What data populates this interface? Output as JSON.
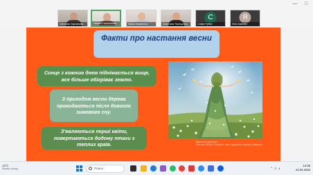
{
  "participants": [
    {
      "name": "Світлана Харланова"
    },
    {
      "name": "Наталя Горілянська"
    },
    {
      "name": "Настя Коваленко"
    },
    {
      "name": "Анастасія Терещенко"
    },
    {
      "name": "Софія Рубан",
      "initial": "С",
      "color": "#1e6b4f"
    },
    {
      "name": "Яна Савенко",
      "initial": "Я",
      "color": "#bca79e"
    }
  ],
  "window_controls": {
    "minimize": "—",
    "maximize": "□"
  },
  "slide": {
    "title": "Факти про настання весни",
    "facts": [
      "Сонце з кожним днем піднімається вище, все більше обігріває землю.",
      "З приходом весни дерева прокидаються після довгого зимового сну.",
      "З'являються перші квіти, повертаються додому птахи з теплих країв."
    ],
    "painting_icon": "spring-goddess-painting",
    "caption_line1": "Валентин Шевченко",
    "caption_line2": "«Весна» 2016 р. Полотно, олія. Художник–творець Київщини"
  },
  "taskbar": {
    "temperature": "13°C",
    "weather": "Mostly cloudy",
    "search_placeholder": "Поиск",
    "time": "12:06",
    "date": "22.04.2020"
  },
  "colors": {
    "slide_bg": "#ff5a17",
    "title_box": "#b2d2ec",
    "title_text": "#1c3f7e",
    "fact_dark": "#588e4e",
    "fact_light": "#89b497",
    "active_speaker": "#4aa564"
  }
}
